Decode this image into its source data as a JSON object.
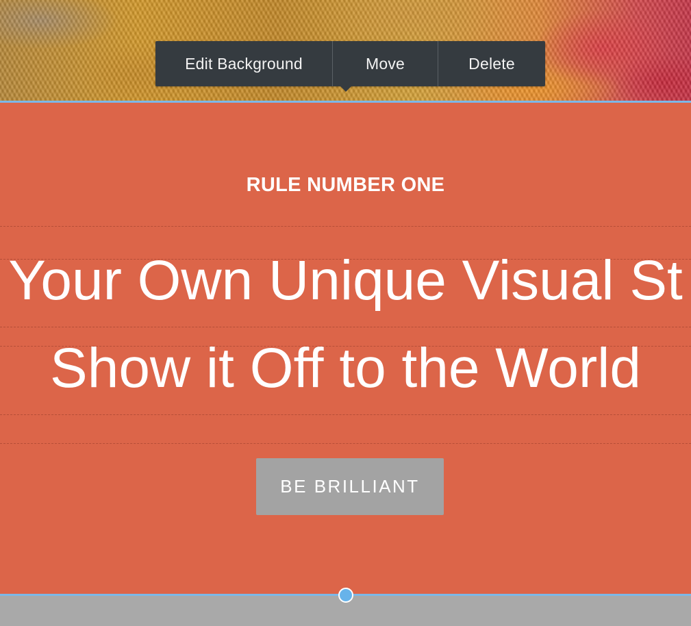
{
  "toolbar": {
    "edit_background_label": "Edit Background",
    "move_label": "Move",
    "delete_label": "Delete"
  },
  "section": {
    "eyebrow": "RULE NUMBER ONE",
    "headline_line1": "Your Own Unique Visual St",
    "headline_line2": "Show it Off to the World",
    "cta_label": "BE BRILLIANT"
  },
  "colors": {
    "section_bg": "#dc6549",
    "toolbar_bg": "#353b40",
    "selection_outline": "#7cb8e8",
    "cta_bg": "#a3a3a3"
  }
}
